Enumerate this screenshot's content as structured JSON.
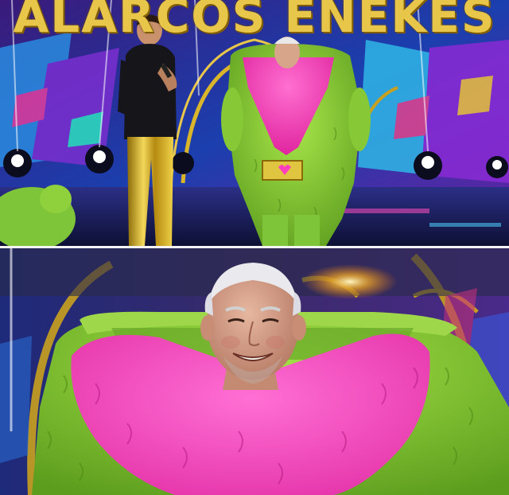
{
  "top_panel": {
    "banner_text": "ALARCOS ENEKES"
  },
  "colors": {
    "costume_green": "#8ed13c",
    "costume_pink": "#ff3fbd",
    "stage_purple": "#4a1f8c",
    "stage_blue": "#1f5fd6",
    "gold": "#d8b52a",
    "banner_gold": "#e8c64a"
  }
}
